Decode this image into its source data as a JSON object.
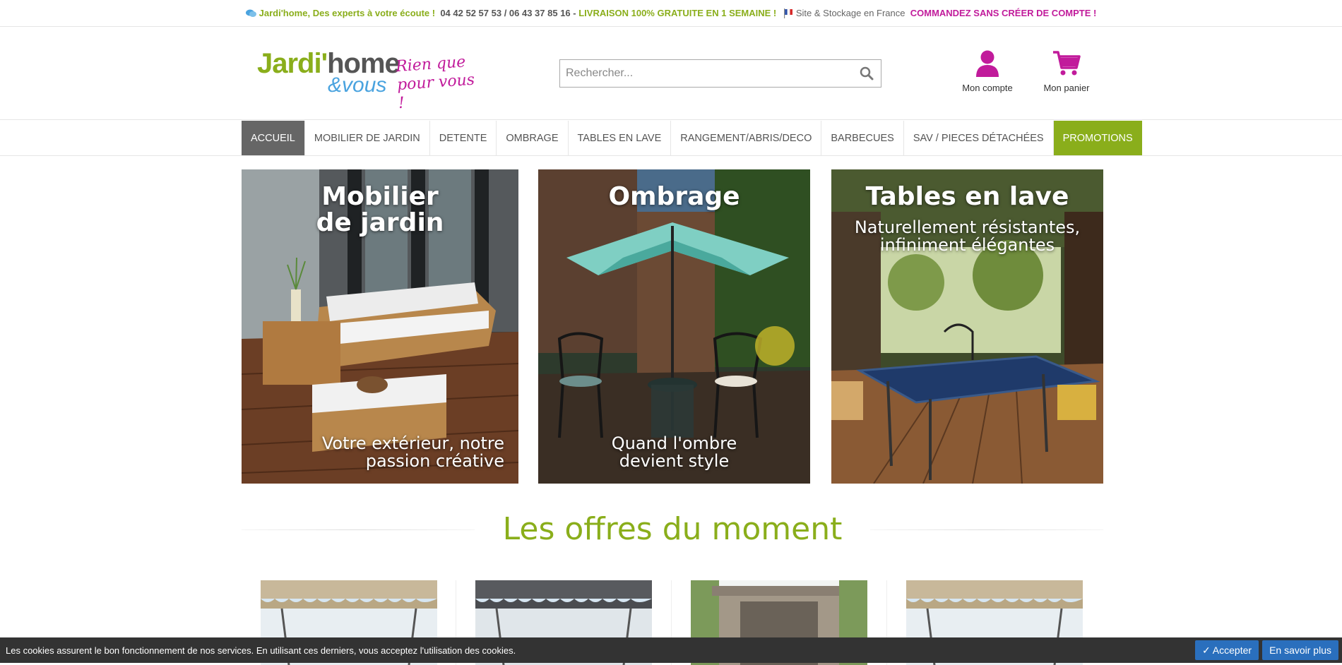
{
  "topbar": {
    "contact": "Jardi'home, Des experts à votre écoute ! ",
    "phones": " 04 42 52 57 53 / 06 43 37 85 16 - ",
    "delivery": "LIVRAISON 100% GRATUITE EN 1 SEMAINE ! ",
    "stock": "Site & Stockage en France ",
    "no_account": " COMMANDEZ SANS CRÉER DE COMPTE !"
  },
  "logo": {
    "part1": "Jardi'",
    "part2": "home",
    "part3": "&vous",
    "tagline": "Rien que\npour vous !"
  },
  "search": {
    "placeholder": "Rechercher..."
  },
  "header": {
    "account_label": "Mon compte",
    "cart_label": "Mon panier"
  },
  "nav": {
    "items": [
      "ACCUEIL",
      "MOBILIER DE JARDIN",
      "DETENTE",
      "OMBRAGE",
      "TABLES EN LAVE",
      "RANGEMENT/ABRIS/DECO",
      "BARBECUES",
      "SAV / PIECES DÉTACHÉES",
      "PROMOTIONS"
    ]
  },
  "banners": [
    {
      "title": "Mobilier\nde jardin",
      "subtitle": "Votre extérieur, notre\npassion créative"
    },
    {
      "title": "Ombrage",
      "subtitle": "Quand l'ombre\ndevient style"
    },
    {
      "title": "Tables en lave",
      "subtitle": "Naturellement résistantes,\ninfiniment élégantes"
    }
  ],
  "offers": {
    "title": "Les offres du moment"
  },
  "cookie": {
    "message": "Les cookies assurent le bon fonctionnement de nos services. En utilisant ces derniers, vous acceptez l'utilisation des cookies.",
    "accept": "✓ Accepter",
    "more": "En savoir plus"
  },
  "colors": {
    "green": "#8aae1b",
    "magenta": "#c11b9b",
    "blue": "#2a6fbd"
  }
}
